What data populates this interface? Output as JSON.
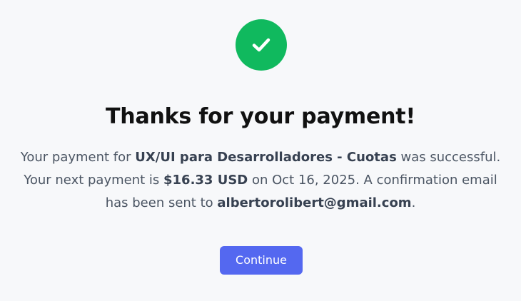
{
  "success_icon": {
    "icon": "check-icon",
    "color": "#10b95e"
  },
  "title": "Thanks for your payment!",
  "message": {
    "line1_prefix": "Your payment for ",
    "course_name": "UX/UI para Desarrolladores - Cuotas",
    "line1_suffix": " was successful.",
    "line2_prefix": "Your next payment is ",
    "next_amount": "$16.33 USD",
    "line2_suffix": " on Oct 16, 2025. A confirmation email",
    "line3_prefix": "has been sent to ",
    "email": "albertorolibert@gmail.com",
    "line3_suffix": "."
  },
  "continue_button": {
    "label": "Continue",
    "color": "#5468f0"
  }
}
